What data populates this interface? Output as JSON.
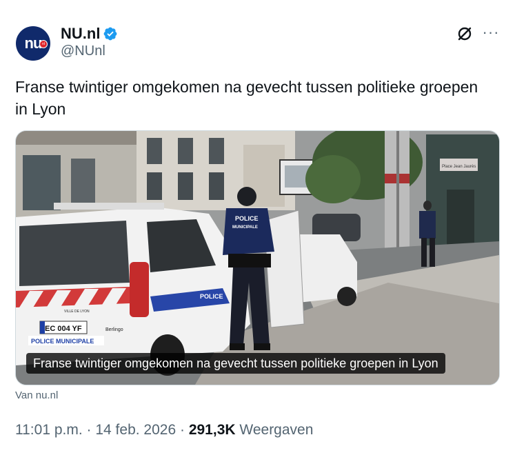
{
  "header": {
    "avatar_text": "nu",
    "avatar_badge": "nl",
    "name": "NU.nl",
    "handle": "@NUnl",
    "verified_icon": "verified-badge-icon",
    "grok_icon": "slash-circle-icon",
    "more_label": "···"
  },
  "tweet": {
    "text": "Franse twintiger omgekomen na gevecht tussen politieke groepen in Lyon"
  },
  "card": {
    "caption": "Franse twintiger omgekomen na gevecht tussen politieke groepen in Lyon",
    "source": "Van nu.nl",
    "van_plate": "EC 004 YF",
    "van_label": "POLICE MUNICIPALE",
    "van_side": "POLICE",
    "officer_back": "POLICE",
    "officer_back_sub": "MUNICIPALE",
    "van_brand": "Berlingo",
    "van_city": "VILLE DE LYON",
    "street_sign": "Place Jean Jaurès"
  },
  "meta": {
    "time": "11:01 p.m.",
    "date": "14 feb. 2026",
    "views_count": "291,3K",
    "views_label": "Weergaven",
    "separator": "·"
  },
  "colors": {
    "brand": "#102a6b",
    "verified": "#1d9bf0",
    "text": "#0f1419",
    "muted": "#536471"
  }
}
